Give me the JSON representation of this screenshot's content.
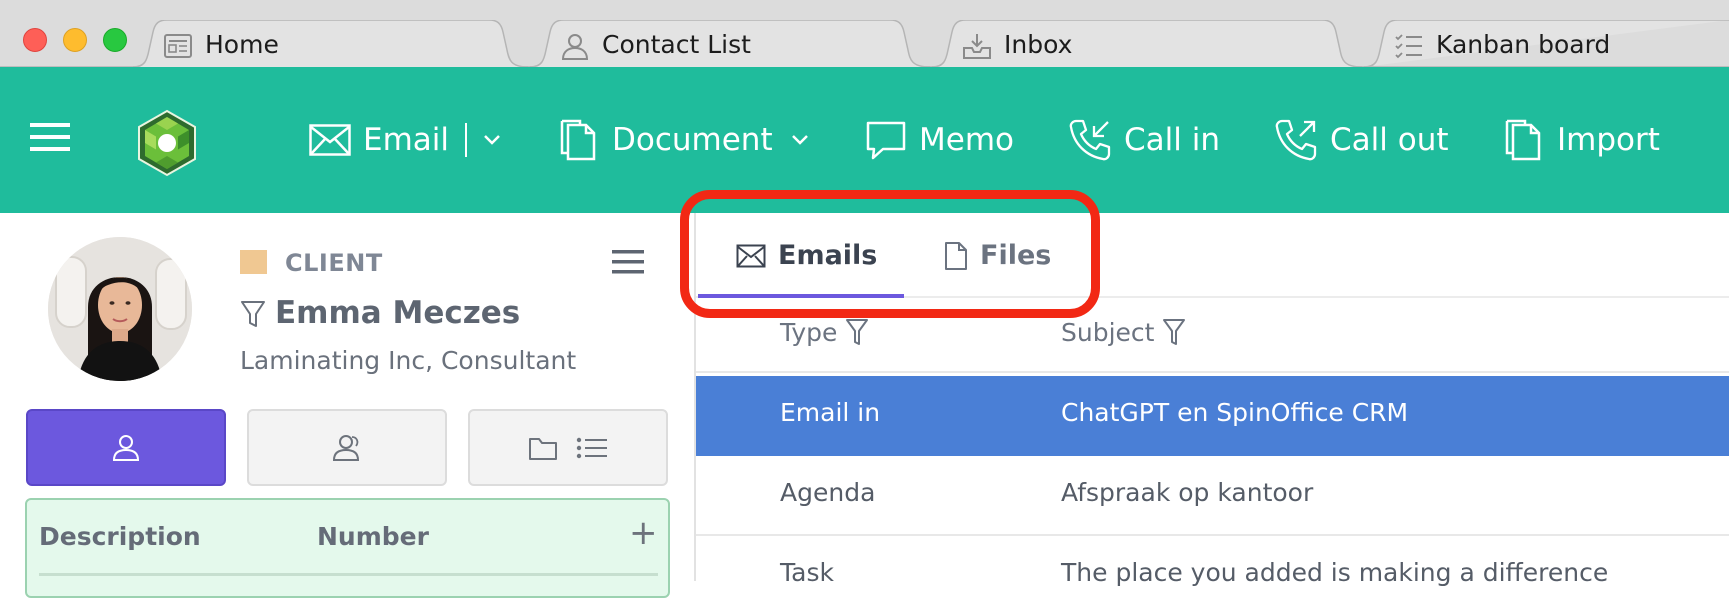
{
  "browser": {
    "tabs": [
      {
        "label": "Home",
        "icon": "newspaper-icon"
      },
      {
        "label": "Contact List",
        "icon": "person-icon"
      },
      {
        "label": "Inbox",
        "icon": "inbox-icon"
      },
      {
        "label": "Kanban board",
        "icon": "checklist-icon"
      }
    ]
  },
  "toolbar": {
    "email_label": "Email",
    "document_label": "Document",
    "memo_label": "Memo",
    "call_in_label": "Call in",
    "call_out_label": "Call out",
    "import_label": "Import"
  },
  "contact": {
    "category": "CLIENT",
    "name": "Emma Meczes",
    "subtitle": "Laminating Inc, Consultant"
  },
  "description_table": {
    "headers": [
      "Description",
      "Number"
    ],
    "add_symbol": "+"
  },
  "right_tabs": [
    {
      "label": "Emails",
      "icon": "envelope-icon",
      "active": true
    },
    {
      "label": "Files",
      "icon": "file-icon",
      "active": false
    }
  ],
  "activity_table": {
    "headers": [
      "Type",
      "Subject"
    ],
    "rows": [
      {
        "type": "Email in",
        "subject": "ChatGPT en SpinOffice CRM",
        "selected": true
      },
      {
        "type": "Agenda",
        "subject": "Afspraak op kantoor",
        "selected": false
      },
      {
        "type": "Task",
        "subject": "The place you added is making a difference",
        "selected": false
      }
    ]
  },
  "colors": {
    "toolbar": "#1fbc9c",
    "accent": "#6c58de",
    "selection": "#4a7fd6",
    "highlight": "#f22814",
    "client_chip": "#f0c892"
  }
}
